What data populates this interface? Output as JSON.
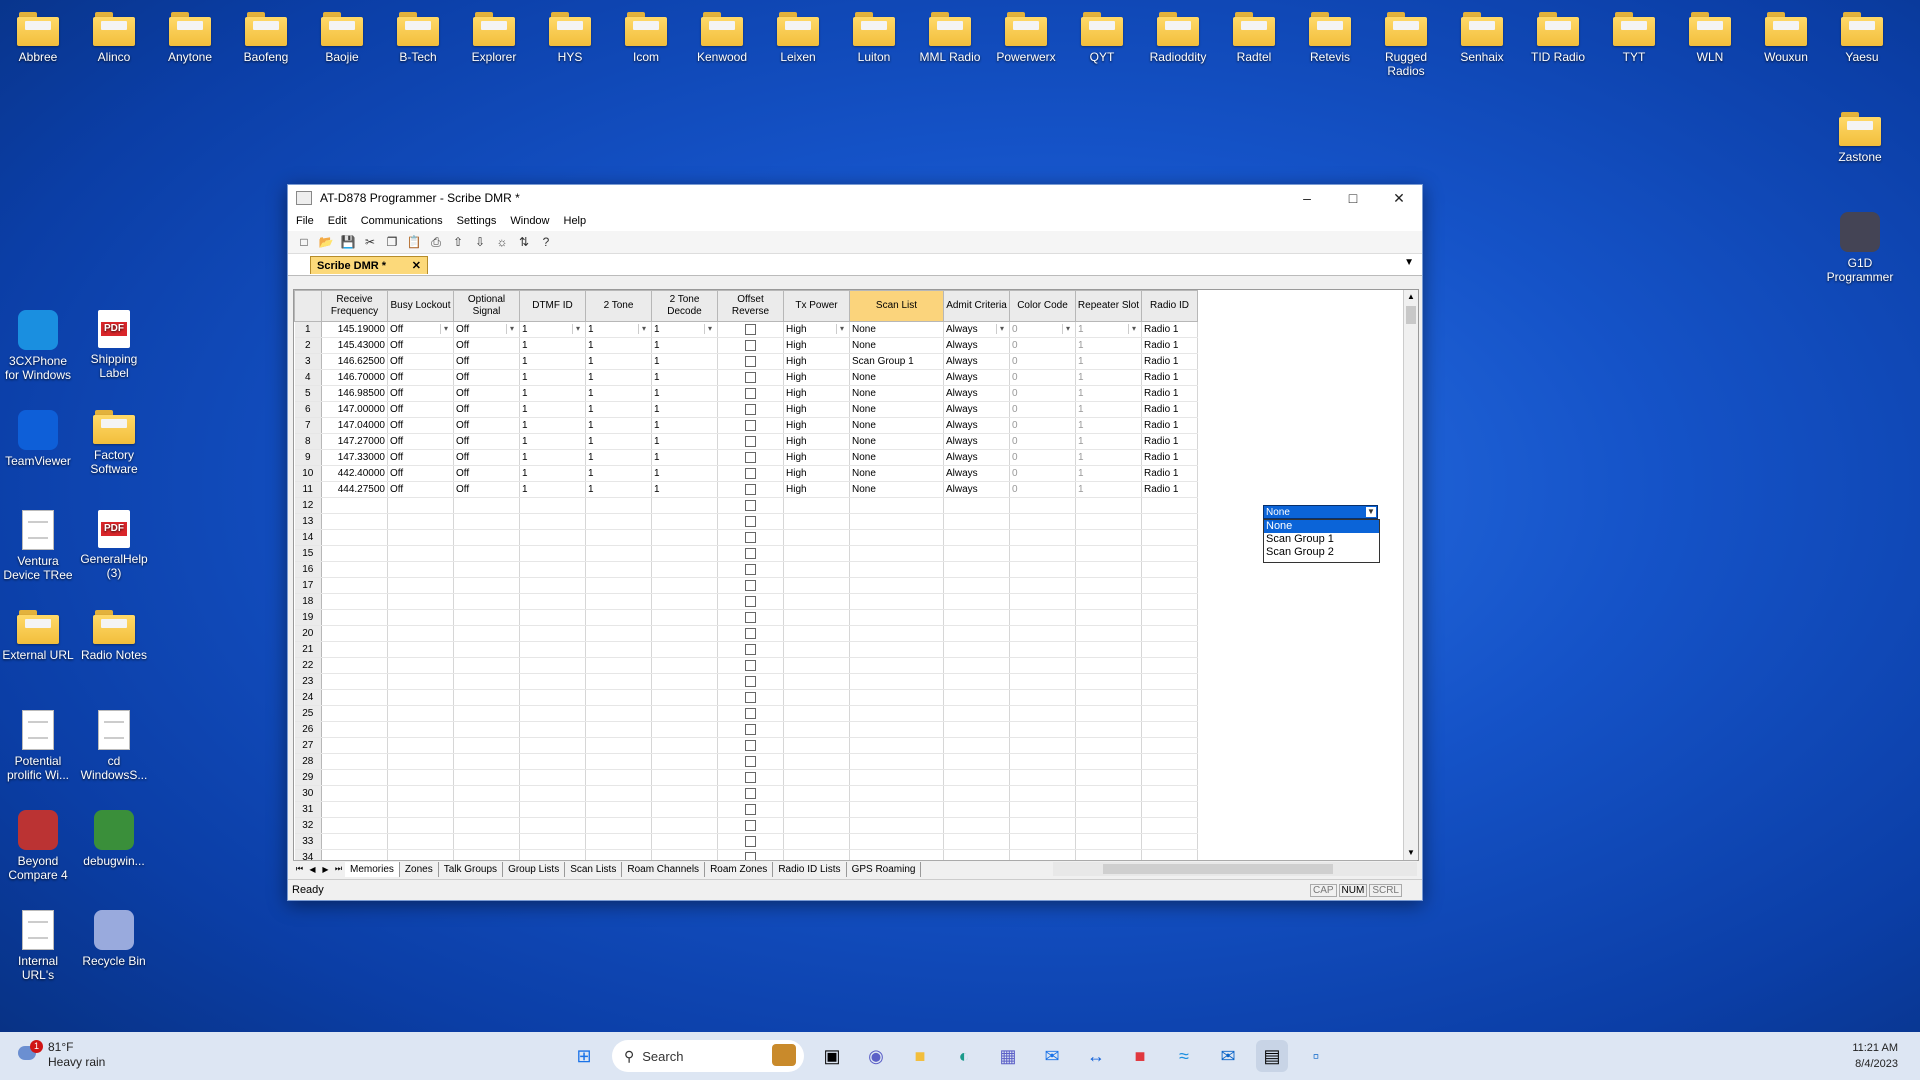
{
  "desktop": {
    "top_folders": [
      "Abbree",
      "Alinco",
      "Anytone",
      "Baofeng",
      "Baojie",
      "B-Tech",
      "Explorer",
      "HYS",
      "Icom",
      "Kenwood",
      "Leixen",
      "Luiton",
      "MML Radio",
      "Powerwerx",
      "QYT",
      "Radioddity",
      "Radtel",
      "Retevis",
      "Rugged Radios",
      "Senhaix",
      "TID Radio",
      "TYT",
      "WLN",
      "Wouxun",
      "Yaesu"
    ],
    "right_icons": [
      "Zastone",
      "G1D Programmer"
    ],
    "left_icons": [
      {
        "label": "3CXPhone for Windows",
        "icon": "wifi-app-icon"
      },
      {
        "label": "Shipping Label",
        "icon": "pdf-icon"
      },
      {
        "label": "TeamViewer",
        "icon": "teamviewer-icon"
      },
      {
        "label": "Factory Software",
        "icon": "folder-icon"
      },
      {
        "label": "Ventura Device TRee",
        "icon": "document-icon"
      },
      {
        "label": "GeneralHelp (3)",
        "icon": "pdf-icon"
      },
      {
        "label": "External URL",
        "icon": "folder-icon"
      },
      {
        "label": "Radio Notes",
        "icon": "folder-icon"
      },
      {
        "label": "Potential prolific Wi...",
        "icon": "document-icon"
      },
      {
        "label": "cd WindowsS...",
        "icon": "document-icon"
      },
      {
        "label": "Beyond Compare 4",
        "icon": "beyond-compare-icon"
      },
      {
        "label": "debugwin...",
        "icon": "debug-app-icon"
      },
      {
        "label": "Internal URL's",
        "icon": "document-icon"
      },
      {
        "label": "Recycle Bin",
        "icon": "recycle-bin-icon"
      }
    ]
  },
  "window": {
    "title": "AT-D878 Programmer - Scribe DMR *",
    "menu": [
      "File",
      "Edit",
      "Communications",
      "Settings",
      "Window",
      "Help"
    ],
    "doc_tab": "Scribe DMR *",
    "columns": [
      "",
      "Receive Frequency",
      "Busy Lockout",
      "Optional Signal",
      "DTMF ID",
      "2 Tone",
      "2 Tone Decode",
      "Offset Reverse",
      "Tx Power",
      "Scan List",
      "Admit Criteria",
      "Color Code",
      "Repeater Slot",
      "Radio ID"
    ],
    "rows": [
      {
        "n": "1",
        "freq": "145.19000",
        "busy": "Off",
        "opt": "Off",
        "dtmf": "1",
        "tone": "1",
        "decode": "1",
        "tx": "High",
        "scan": "None",
        "admit": "Always",
        "cc": "0",
        "slot": "1",
        "rid": "Radio 1"
      },
      {
        "n": "2",
        "freq": "145.43000",
        "busy": "Off",
        "opt": "Off",
        "dtmf": "1",
        "tone": "1",
        "decode": "1",
        "tx": "High",
        "scan": "None",
        "admit": "Always",
        "cc": "0",
        "slot": "1",
        "rid": "Radio 1"
      },
      {
        "n": "3",
        "freq": "146.62500",
        "busy": "Off",
        "opt": "Off",
        "dtmf": "1",
        "tone": "1",
        "decode": "1",
        "tx": "High",
        "scan": "Scan Group 1",
        "admit": "Always",
        "cc": "0",
        "slot": "1",
        "rid": "Radio 1"
      },
      {
        "n": "4",
        "freq": "146.70000",
        "busy": "Off",
        "opt": "Off",
        "dtmf": "1",
        "tone": "1",
        "decode": "1",
        "tx": "High",
        "scan": "None",
        "admit": "Always",
        "cc": "0",
        "slot": "1",
        "rid": "Radio 1"
      },
      {
        "n": "5",
        "freq": "146.98500",
        "busy": "Off",
        "opt": "Off",
        "dtmf": "1",
        "tone": "1",
        "decode": "1",
        "tx": "High",
        "scan": "None",
        "admit": "Always",
        "cc": "0",
        "slot": "1",
        "rid": "Radio 1"
      },
      {
        "n": "6",
        "freq": "147.00000",
        "busy": "Off",
        "opt": "Off",
        "dtmf": "1",
        "tone": "1",
        "decode": "1",
        "tx": "High",
        "scan": "None",
        "admit": "Always",
        "cc": "0",
        "slot": "1",
        "rid": "Radio 1"
      },
      {
        "n": "7",
        "freq": "147.04000",
        "busy": "Off",
        "opt": "Off",
        "dtmf": "1",
        "tone": "1",
        "decode": "1",
        "tx": "High",
        "scan": "None",
        "admit": "Always",
        "cc": "0",
        "slot": "1",
        "rid": "Radio 1"
      },
      {
        "n": "8",
        "freq": "147.27000",
        "busy": "Off",
        "opt": "Off",
        "dtmf": "1",
        "tone": "1",
        "decode": "1",
        "tx": "High",
        "scan": "None",
        "admit": "Always",
        "cc": "0",
        "slot": "1",
        "rid": "Radio 1"
      },
      {
        "n": "9",
        "freq": "147.33000",
        "busy": "Off",
        "opt": "Off",
        "dtmf": "1",
        "tone": "1",
        "decode": "1",
        "tx": "High",
        "scan": "None",
        "admit": "Always",
        "cc": "0",
        "slot": "1",
        "rid": "Radio 1"
      },
      {
        "n": "10",
        "freq": "442.40000",
        "busy": "Off",
        "opt": "Off",
        "dtmf": "1",
        "tone": "1",
        "decode": "1",
        "tx": "High",
        "scan": "None",
        "admit": "Always",
        "cc": "0",
        "slot": "1",
        "rid": "Radio 1"
      },
      {
        "n": "11",
        "freq": "444.27500",
        "busy": "Off",
        "opt": "Off",
        "dtmf": "1",
        "tone": "1",
        "decode": "1",
        "tx": "High",
        "scan": "None",
        "admit": "Always",
        "cc": "0",
        "slot": "1",
        "rid": "Radio 1"
      }
    ],
    "empty_row_numbers": [
      "12",
      "13",
      "14",
      "15",
      "16",
      "17",
      "18",
      "19",
      "20",
      "21",
      "22",
      "23",
      "24",
      "25",
      "26",
      "27",
      "28",
      "29",
      "30",
      "31",
      "32",
      "33",
      "34"
    ],
    "scan_dropdown": {
      "value": "None",
      "options": [
        "None",
        "Scan Group 1",
        "Scan Group 2"
      ]
    },
    "sheet_tabs": [
      "Memories",
      "Zones",
      "Talk Groups",
      "Group Lists",
      "Scan Lists",
      "Roam Channels",
      "Roam Zones",
      "Radio ID Lists",
      "GPS Roaming"
    ],
    "status": "Ready",
    "indicators": [
      "CAP",
      "NUM",
      "SCRL"
    ]
  },
  "taskbar": {
    "temp": "81°F",
    "condition": "Heavy rain",
    "badge": "1",
    "search_placeholder": "Search",
    "time": "11:21 AM",
    "date": "8/4/2023"
  }
}
